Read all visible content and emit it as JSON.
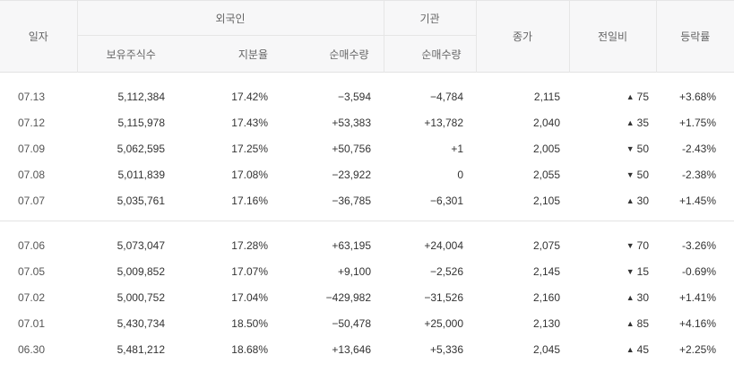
{
  "header": {
    "date": "일자",
    "foreign_group": "외국인",
    "institution_group": "기관",
    "close": "종가",
    "change": "전일비",
    "rate": "등락률",
    "holdings": "보유주식수",
    "share_ratio": "지분율",
    "foreign_net": "순매수량",
    "institution_net": "순매수량"
  },
  "colors": {
    "up": "#e0332b",
    "down": "#2e5ebc"
  },
  "rows_group1": [
    {
      "date": "07.13",
      "holdings": "5,112,384",
      "ratio": "17.42%",
      "foreign_net": "−3,594",
      "inst_net": "−4,784",
      "close": "2,115",
      "change_dir": "up",
      "change_arrow": "▲",
      "change": "75",
      "rate": "+3.68%"
    },
    {
      "date": "07.12",
      "holdings": "5,115,978",
      "ratio": "17.43%",
      "foreign_net": "+53,383",
      "inst_net": "+13,782",
      "close": "2,040",
      "change_dir": "up",
      "change_arrow": "▲",
      "change": "35",
      "rate": "+1.75%"
    },
    {
      "date": "07.09",
      "holdings": "5,062,595",
      "ratio": "17.25%",
      "foreign_net": "+50,756",
      "inst_net": "+1",
      "close": "2,005",
      "change_dir": "down",
      "change_arrow": "▼",
      "change": "50",
      "rate": "-2.43%"
    },
    {
      "date": "07.08",
      "holdings": "5,011,839",
      "ratio": "17.08%",
      "foreign_net": "−23,922",
      "inst_net": "0",
      "close": "2,055",
      "change_dir": "down",
      "change_arrow": "▼",
      "change": "50",
      "rate": "-2.38%"
    },
    {
      "date": "07.07",
      "holdings": "5,035,761",
      "ratio": "17.16%",
      "foreign_net": "−36,785",
      "inst_net": "−6,301",
      "close": "2,105",
      "change_dir": "up",
      "change_arrow": "▲",
      "change": "30",
      "rate": "+1.45%"
    }
  ],
  "rows_group2": [
    {
      "date": "07.06",
      "holdings": "5,073,047",
      "ratio": "17.28%",
      "foreign_net": "+63,195",
      "inst_net": "+24,004",
      "close": "2,075",
      "change_dir": "down",
      "change_arrow": "▼",
      "change": "70",
      "rate": "-3.26%"
    },
    {
      "date": "07.05",
      "holdings": "5,009,852",
      "ratio": "17.07%",
      "foreign_net": "+9,100",
      "inst_net": "−2,526",
      "close": "2,145",
      "change_dir": "down",
      "change_arrow": "▼",
      "change": "15",
      "rate": "-0.69%"
    },
    {
      "date": "07.02",
      "holdings": "5,000,752",
      "ratio": "17.04%",
      "foreign_net": "−429,982",
      "inst_net": "−31,526",
      "close": "2,160",
      "change_dir": "up",
      "change_arrow": "▲",
      "change": "30",
      "rate": "+1.41%"
    },
    {
      "date": "07.01",
      "holdings": "5,430,734",
      "ratio": "18.50%",
      "foreign_net": "−50,478",
      "inst_net": "+25,000",
      "close": "2,130",
      "change_dir": "up",
      "change_arrow": "▲",
      "change": "85",
      "rate": "+4.16%"
    },
    {
      "date": "06.30",
      "holdings": "5,481,212",
      "ratio": "18.68%",
      "foreign_net": "+13,646",
      "inst_net": "+5,336",
      "close": "2,045",
      "change_dir": "up",
      "change_arrow": "▲",
      "change": "45",
      "rate": "+2.25%"
    }
  ]
}
